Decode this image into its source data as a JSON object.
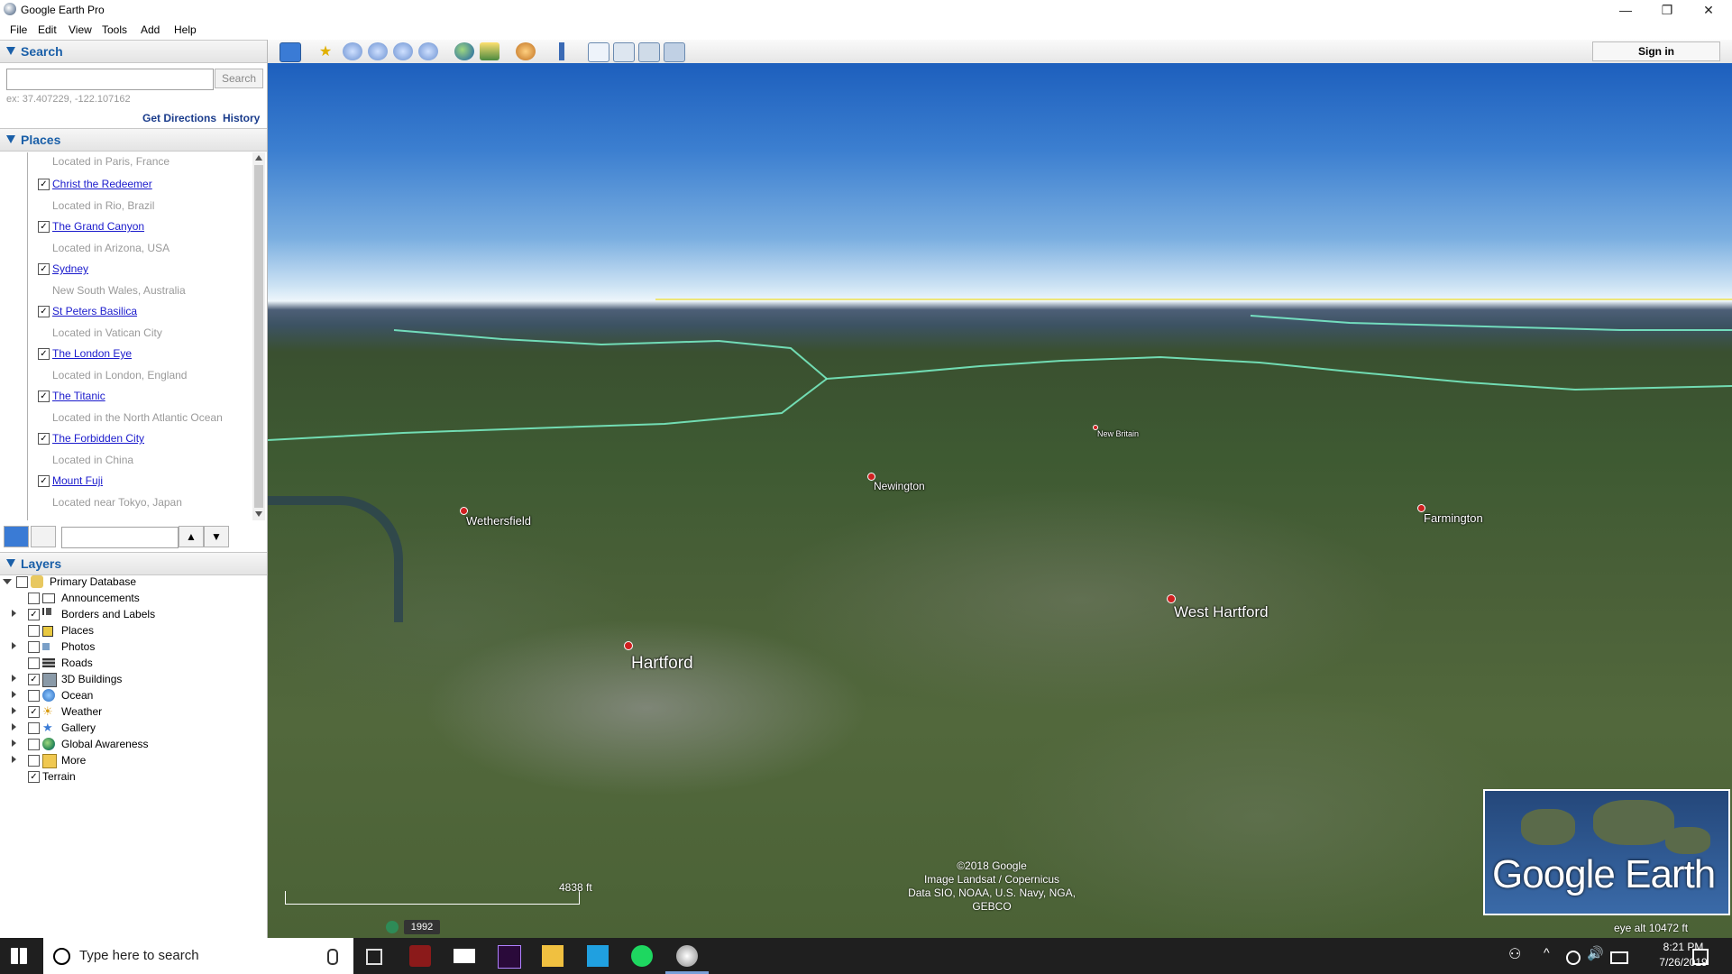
{
  "window": {
    "title": "Google Earth Pro"
  },
  "menu": [
    "File",
    "Edit",
    "View",
    "Tools",
    "Add",
    "Help"
  ],
  "search": {
    "header": "Search",
    "placeholder": "",
    "button": "Search",
    "hint": "ex: 37.407229, -122.107162",
    "get_directions": "Get Directions",
    "history": "History"
  },
  "places": {
    "header": "Places",
    "first_desc": "Located in Paris, France",
    "items": [
      {
        "name": "Christ the Redeemer",
        "desc": "Located in Rio, Brazil"
      },
      {
        "name": "The Grand Canyon",
        "desc": "Located in Arizona, USA"
      },
      {
        "name": "Sydney",
        "desc": "New South Wales, Australia"
      },
      {
        "name": "St Peters Basilica",
        "desc": "Located in Vatican City"
      },
      {
        "name": "The London Eye",
        "desc": "Located in London, England"
      },
      {
        "name": "The Titanic",
        "desc": "Located in the North Atlantic Ocean"
      },
      {
        "name": "The Forbidden City",
        "desc": "Located in China"
      },
      {
        "name": "Mount Fuji",
        "desc": "Located near Tokyo, Japan"
      }
    ]
  },
  "layers": {
    "header": "Layers",
    "items": [
      {
        "label": "Primary Database",
        "checked": false,
        "icon": "database-icon"
      },
      {
        "label": "Announcements",
        "checked": false,
        "icon": "envelope-icon"
      },
      {
        "label": "Borders and Labels",
        "checked": true,
        "icon": "flag-icon"
      },
      {
        "label": "Places",
        "checked": false,
        "icon": "places-icon"
      },
      {
        "label": "Photos",
        "checked": false,
        "icon": "photo-icon"
      },
      {
        "label": "Roads",
        "checked": false,
        "icon": "road-icon"
      },
      {
        "label": "3D Buildings",
        "checked": true,
        "icon": "buildings-icon"
      },
      {
        "label": "Ocean",
        "checked": false,
        "icon": "ocean-icon"
      },
      {
        "label": "Weather",
        "checked": true,
        "icon": "sun-icon"
      },
      {
        "label": "Gallery",
        "checked": false,
        "icon": "star-icon"
      },
      {
        "label": "Global Awareness",
        "checked": false,
        "icon": "globe-icon"
      },
      {
        "label": "More",
        "checked": false,
        "icon": "folder-icon"
      },
      {
        "label": "Terrain",
        "checked": true,
        "icon": ""
      }
    ]
  },
  "toolbar": {
    "sign_in": "Sign in"
  },
  "map": {
    "towns": [
      "Wethersfield",
      "Newington",
      "New Britain",
      "Farmington",
      "West Hartford",
      "Hartford"
    ],
    "attribution": [
      "©2018 Google",
      "Image Landsat / Copernicus",
      "Data SIO, NOAA, U.S. Navy, NGA, GEBCO"
    ],
    "scale_label": "4838 ft",
    "history_year": "1992",
    "eye_alt": "eye alt  10472 ft",
    "brand": "Google Earth"
  },
  "taskbar": {
    "search_placeholder": "Type here to search",
    "time": "8:21 PM",
    "date": "7/26/2019"
  }
}
